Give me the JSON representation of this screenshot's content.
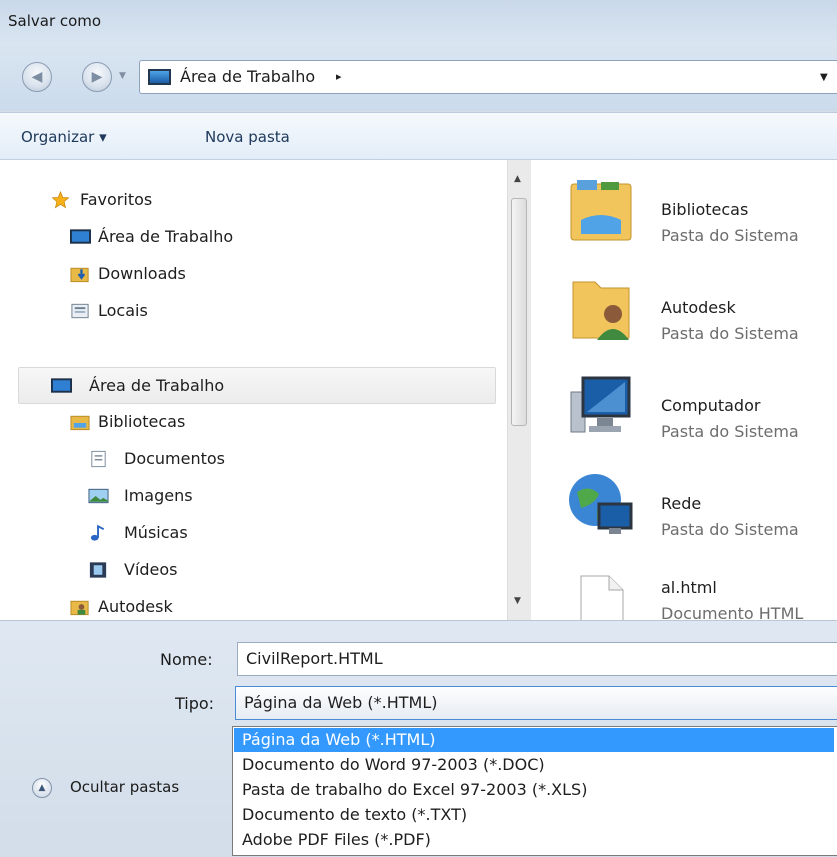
{
  "window": {
    "title": "Salvar como"
  },
  "address_bar": {
    "location": "Área de Trabalho",
    "separator": "▸"
  },
  "toolbar": {
    "organize_label": "Organizar ▾",
    "new_folder_label": "Nova pasta"
  },
  "nav_pane": {
    "items": [
      {
        "label": "Favoritos",
        "icon": "star-icon"
      },
      {
        "label": "Área de Trabalho",
        "icon": "desktop-icon"
      },
      {
        "label": "Downloads",
        "icon": "downloads-folder-icon"
      },
      {
        "label": "Locais",
        "icon": "recent-places-icon"
      },
      {
        "label": "Área de Trabalho",
        "icon": "desktop-icon",
        "selected": true
      },
      {
        "label": "Bibliotecas",
        "icon": "libraries-icon"
      },
      {
        "label": "Documentos",
        "icon": "documents-icon"
      },
      {
        "label": "Imagens",
        "icon": "pictures-icon"
      },
      {
        "label": "Músicas",
        "icon": "music-icon"
      },
      {
        "label": "Vídeos",
        "icon": "videos-icon"
      },
      {
        "label": "Autodesk",
        "icon": "user-folder-icon"
      }
    ]
  },
  "content_items": [
    {
      "name": "Bibliotecas",
      "type": "Pasta do Sistema",
      "icon": "libraries-folder-icon"
    },
    {
      "name": "Autodesk",
      "type": "Pasta do Sistema",
      "icon": "user-folder-icon"
    },
    {
      "name": "Computador",
      "type": "Pasta do Sistema",
      "icon": "computer-icon"
    },
    {
      "name": "Rede",
      "type": "Pasta do Sistema",
      "icon": "network-icon"
    },
    {
      "name": "al.html",
      "type": "Documento HTML",
      "icon": "html-file-icon"
    }
  ],
  "form": {
    "name_label": "Nome:",
    "name_value": "CivilReport.HTML",
    "type_label": "Tipo:",
    "type_value": "Página da Web (*.HTML)",
    "type_options": [
      "Página da Web (*.HTML)",
      "Documento do Word 97-2003 (*.DOC)",
      "Pasta de trabalho do Excel 97-2003 (*.XLS)",
      "Documento de texto (*.TXT)",
      "Adobe PDF Files (*.PDF)"
    ]
  },
  "hide_folders_label": "Ocultar pastas",
  "colors": {
    "highlight": "#3399ff",
    "chrome": "#c9d8ea",
    "toolbar_text": "#1e395b"
  }
}
